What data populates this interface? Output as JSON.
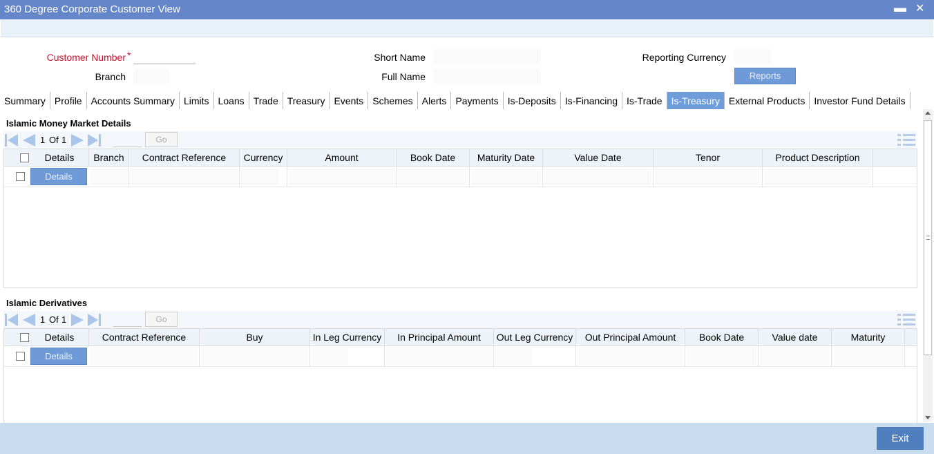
{
  "window": {
    "title": "360 Degree Corporate Customer View",
    "minimize_icon": "minimize-icon",
    "close_icon": "close-icon"
  },
  "header": {
    "customer_number_label": "Customer Number",
    "required_mark": "*",
    "branch_label": "Branch",
    "short_name_label": "Short Name",
    "full_name_label": "Full Name",
    "reporting_currency_label": "Reporting Currency",
    "reports_button": "Reports",
    "required_color": "#c8102e"
  },
  "tabs": [
    {
      "label": "Summary"
    },
    {
      "label": "Profile"
    },
    {
      "label": "Accounts Summary"
    },
    {
      "label": "Limits"
    },
    {
      "label": "Loans"
    },
    {
      "label": "Trade"
    },
    {
      "label": "Treasury"
    },
    {
      "label": "Events"
    },
    {
      "label": "Schemes"
    },
    {
      "label": "Alerts"
    },
    {
      "label": "Payments"
    },
    {
      "label": "Is-Deposits"
    },
    {
      "label": "Is-Financing"
    },
    {
      "label": "Is-Trade"
    },
    {
      "label": "Is-Treasury",
      "active": true
    },
    {
      "label": "External Products"
    },
    {
      "label": "Investor Fund Details"
    }
  ],
  "money_market": {
    "title": "Islamic Money Market Details",
    "pager": {
      "current": "1",
      "of_label": "Of",
      "total": "1",
      "go_label": "Go"
    },
    "columns": [
      "Details",
      "Branch",
      "Contract Reference",
      "Currency",
      "Amount",
      "Book Date",
      "Maturity Date",
      "Value Date",
      "Tenor",
      "Product Description"
    ],
    "row_details_button": "Details"
  },
  "derivatives": {
    "title": "Islamic Derivatives",
    "pager": {
      "current": "1",
      "of_label": "Of",
      "total": "1",
      "go_label": "Go"
    },
    "columns": [
      "Details",
      "Contract Reference",
      "Buy",
      "In Leg Currency",
      "In Principal Amount",
      "Out Leg Currency",
      "Out Principal Amount",
      "Book Date",
      "Value date",
      "Maturity"
    ],
    "row_details_button": "Details"
  },
  "footer": {
    "exit_button": "Exit"
  },
  "colors": {
    "title_bar": "#6587c9",
    "active_tab": "#6f9dd9",
    "button": "#6e9ad8",
    "footer": "#c9ddf0",
    "exit_button": "#4f7fbf"
  }
}
